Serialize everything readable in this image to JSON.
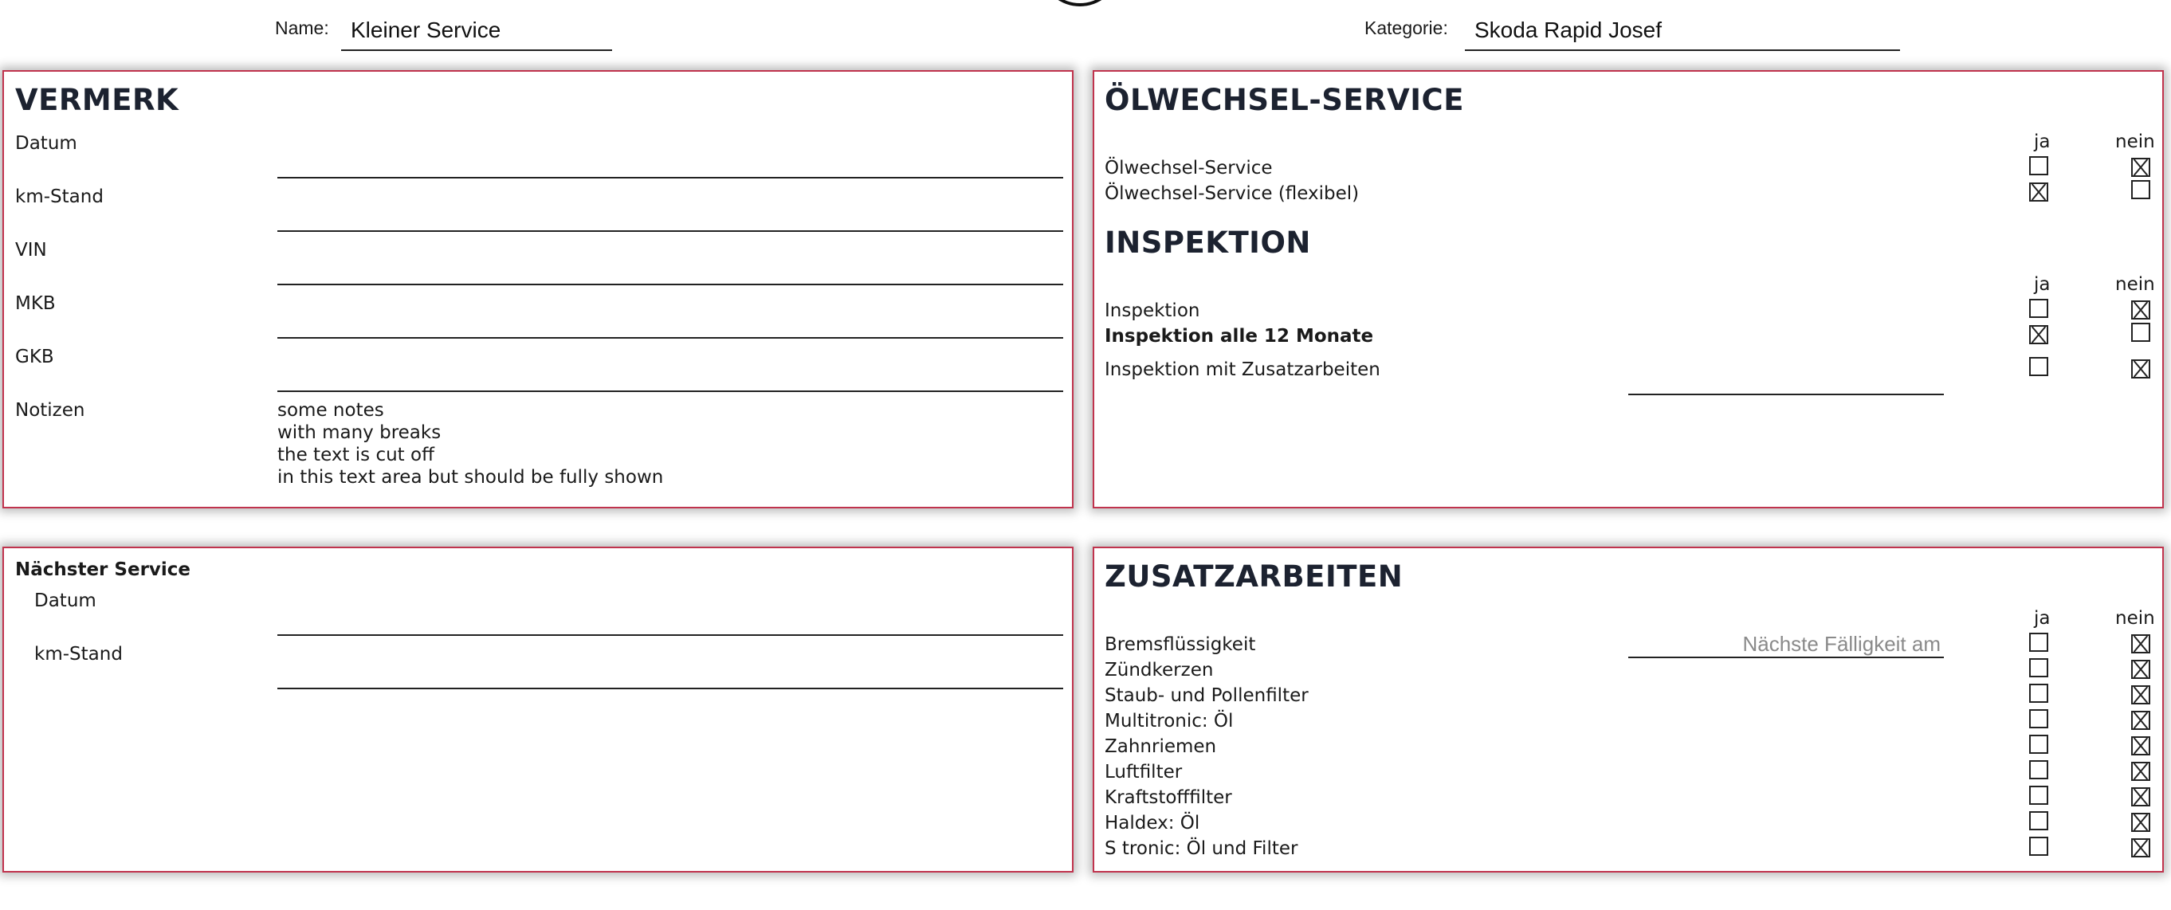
{
  "header": {
    "name_label": "Name:",
    "name_value": "Kleiner Service",
    "category_label": "Kategorie:",
    "category_value": "Skoda Rapid Josef"
  },
  "vermerk": {
    "title": "VERMERK",
    "fields": [
      "Datum",
      "km-Stand",
      "VIN",
      "MKB",
      "GKB"
    ],
    "notes_label": "Notizen",
    "notes_lines": [
      "some notes",
      "with many breaks",
      "the text is cut off",
      "in this text area but should be fully shown"
    ]
  },
  "oelwechsel": {
    "title": "ÖLWECHSEL-SERVICE",
    "col_yes": "ja",
    "col_no": "nein",
    "rows": [
      {
        "label": "Ölwechsel-Service",
        "ja": false,
        "nein": true,
        "bold": false
      },
      {
        "label": "Ölwechsel-Service (flexibel)",
        "ja": true,
        "nein": false,
        "bold": false
      }
    ]
  },
  "inspektion": {
    "title": "INSPEKTION",
    "col_yes": "ja",
    "col_no": "nein",
    "rows": [
      {
        "label": "Inspektion",
        "ja": false,
        "nein": true,
        "bold": false
      },
      {
        "label": "Inspektion alle 12 Monate",
        "ja": true,
        "nein": false,
        "bold": true
      },
      {
        "label": "Inspektion mit Zusatzarbeiten",
        "ja": false,
        "nein": true,
        "bold": false
      }
    ]
  },
  "naechster_service": {
    "title": "Nächster Service",
    "fields": [
      "Datum",
      "km-Stand"
    ]
  },
  "zusatzarbeiten": {
    "title": "ZUSATZARBEITEN",
    "col_yes": "ja",
    "col_no": "nein",
    "due_placeholder": "Nächste Fälligkeit am",
    "rows": [
      {
        "label": "Bremsflüssigkeit",
        "ja": false,
        "nein": true
      },
      {
        "label": "Zündkerzen",
        "ja": false,
        "nein": true
      },
      {
        "label": "Staub- und Pollenfilter",
        "ja": false,
        "nein": true
      },
      {
        "label": "Multitronic: Öl",
        "ja": false,
        "nein": true
      },
      {
        "label": "Zahnriemen",
        "ja": false,
        "nein": true
      },
      {
        "label": "Luftfilter",
        "ja": false,
        "nein": true
      },
      {
        "label": "Kraftstofffilter",
        "ja": false,
        "nein": true
      },
      {
        "label": "Haldex: Öl",
        "ja": false,
        "nein": true
      },
      {
        "label": "S tronic: Öl und Filter",
        "ja": false,
        "nein": true
      }
    ]
  }
}
